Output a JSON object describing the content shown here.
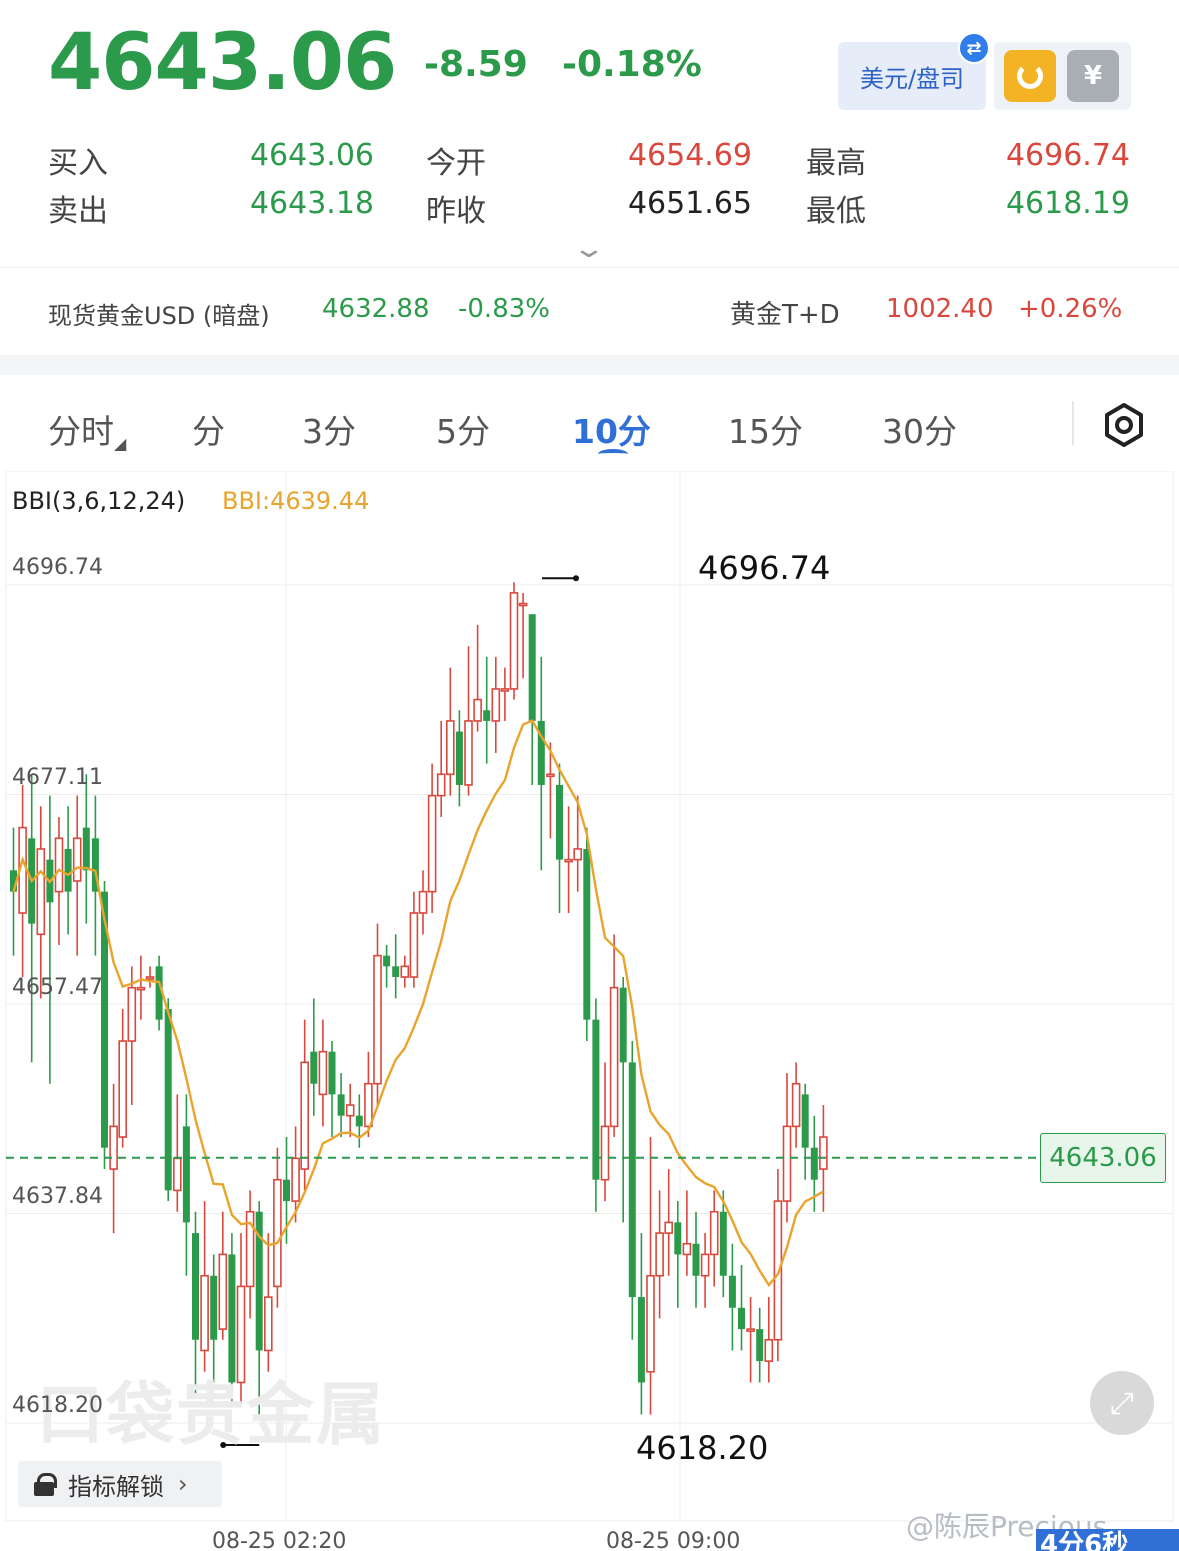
{
  "quote": {
    "price": "4643.06",
    "change": "-8.59",
    "change_pct": "-0.18%",
    "unit_toggle": "美元/盘司",
    "bid_label": "买入",
    "bid": "4643.06",
    "ask_label": "卖出",
    "ask": "4643.18",
    "open_label": "今开",
    "open": "4654.69",
    "prev_close_label": "昨收",
    "prev_close": "4651.65",
    "high_label": "最高",
    "high": "4696.74",
    "low_label": "最低",
    "low": "4618.19"
  },
  "ticker": {
    "spot_name": "现货黄金USD (暗盘)",
    "spot_price": "4632.88",
    "spot_pct": "-0.83%",
    "td_name": "黄金T+D",
    "td_price": "1002.40",
    "td_pct": "+0.26%"
  },
  "tabs": [
    {
      "label": "分时"
    },
    {
      "label": "分"
    },
    {
      "label": "3分"
    },
    {
      "label": "5分"
    },
    {
      "label": "10分"
    },
    {
      "label": "15分"
    },
    {
      "label": "30分"
    }
  ],
  "active_tab": "10分",
  "chart_meta": {
    "indicator": "BBI(3,6,12,24)",
    "indicator_value": "BBI:4639.44",
    "current_price_tag": "4643.06",
    "watermark": "口袋贵金属",
    "unlock_label": "指标解锁",
    "weibo": "@陈辰Precious",
    "countdown": "4分6秒"
  },
  "colors": {
    "up": "#d9473d",
    "down": "#2c9a4b",
    "bbi": "#e8a42c",
    "accent": "#2f6fd6"
  },
  "icons": [
    "swap-icon",
    "refresh-icon",
    "coin-icon",
    "chevron-down-icon",
    "settings-icon",
    "expand-icon",
    "lock-icon",
    "chevron-right-icon"
  ],
  "chart_data": {
    "type": "candlestick",
    "ylim": [
      4618.2,
      4696.74
    ],
    "y_ticks": [
      "4696.74",
      "4677.11",
      "4657.47",
      "4637.84",
      "4618.20"
    ],
    "x_ticks": [
      "08-25 02:20",
      "08-25 09:00"
    ],
    "high_marker": "4696.74",
    "low_marker": "4618.20",
    "current_price": 4643.06,
    "candles": [
      [
        4670,
        4668,
        4674,
        4662
      ],
      [
        4666,
        4674,
        4678,
        4660
      ],
      [
        4673,
        4665,
        4679,
        4652
      ],
      [
        4664,
        4672,
        4676,
        4658
      ],
      [
        4671,
        4667,
        4677,
        4650
      ],
      [
        4668,
        4673,
        4675,
        4663
      ],
      [
        4672,
        4668,
        4676,
        4664
      ],
      [
        4669,
        4673,
        4677,
        4662
      ],
      [
        4674,
        4670,
        4679,
        4665
      ],
      [
        4673,
        4668,
        4677,
        4662
      ],
      [
        4668,
        4644,
        4669,
        4642
      ],
      [
        4642,
        4646,
        4650,
        4636
      ],
      [
        4645,
        4654,
        4657,
        4644
      ],
      [
        4654,
        4659,
        4661,
        4648
      ],
      [
        4659,
        4659,
        4662,
        4656
      ],
      [
        4660,
        4660,
        4661,
        4659
      ],
      [
        4661,
        4656,
        4662,
        4655
      ],
      [
        4657,
        4640,
        4658,
        4639
      ],
      [
        4640,
        4643,
        4649,
        4638
      ],
      [
        4646,
        4637,
        4649,
        4632
      ],
      [
        4636,
        4626,
        4638,
        4621
      ],
      [
        4625,
        4632,
        4639,
        4623
      ],
      [
        4632,
        4626,
        4634,
        4622
      ],
      [
        4627,
        4634,
        4638,
        4626
      ],
      [
        4634,
        4622,
        4636,
        4620
      ],
      [
        4622,
        4631,
        4636,
        4620
      ],
      [
        4631,
        4638,
        4640,
        4628
      ],
      [
        4638,
        4625,
        4639,
        4619
      ],
      [
        4625,
        4630,
        4636,
        4623
      ],
      [
        4631,
        4641,
        4644,
        4629
      ],
      [
        4641,
        4639,
        4645,
        4635
      ],
      [
        4639,
        4643,
        4646,
        4637
      ],
      [
        4642,
        4652,
        4656,
        4640
      ],
      [
        4653,
        4650,
        4658,
        4647
      ],
      [
        4649,
        4653,
        4656,
        4646
      ],
      [
        4653,
        4649,
        4654,
        4645
      ],
      [
        4649,
        4647,
        4651,
        4645
      ],
      [
        4647,
        4648,
        4650,
        4645
      ],
      [
        4647,
        4646,
        4649,
        4644
      ],
      [
        4646,
        4650,
        4653,
        4645
      ],
      [
        4650,
        4662,
        4665,
        4648
      ],
      [
        4662,
        4661,
        4663,
        4659
      ],
      [
        4661,
        4660,
        4664,
        4658
      ],
      [
        4660,
        4661,
        4662,
        4659
      ],
      [
        4660,
        4666,
        4668,
        4659
      ],
      [
        4666,
        4668,
        4670,
        4664
      ],
      [
        4668,
        4677,
        4680,
        4666
      ],
      [
        4677,
        4679,
        4684,
        4675
      ],
      [
        4679,
        4684,
        4689,
        4677
      ],
      [
        4683,
        4678,
        4685,
        4676
      ],
      [
        4678,
        4684,
        4691,
        4677
      ],
      [
        4684,
        4686,
        4693,
        4683
      ],
      [
        4685,
        4684,
        4690,
        4680
      ],
      [
        4684,
        4687,
        4690,
        4681
      ],
      [
        4687,
        4687,
        4689,
        4684
      ],
      [
        4687,
        4696,
        4697,
        4686
      ],
      [
        4695,
        4695,
        4696,
        4688
      ],
      [
        4694,
        4684,
        4694,
        4678
      ],
      [
        4684,
        4678,
        4690,
        4670
      ],
      [
        4679,
        4679,
        4682,
        4673
      ],
      [
        4678,
        4671,
        4680,
        4666
      ],
      [
        4671,
        4671,
        4676,
        4666
      ],
      [
        4671,
        4672,
        4677,
        4668
      ],
      [
        4672,
        4656,
        4674,
        4654
      ],
      [
        4656,
        4641,
        4658,
        4638
      ],
      [
        4641,
        4646,
        4652,
        4639
      ],
      [
        4646,
        4659,
        4664,
        4645
      ],
      [
        4659,
        4652,
        4660,
        4637
      ],
      [
        4652,
        4630,
        4654,
        4626
      ],
      [
        4630,
        4622,
        4636,
        4619
      ],
      [
        4623,
        4632,
        4645,
        4619
      ],
      [
        4632,
        4636,
        4640,
        4628
      ],
      [
        4636,
        4637,
        4642,
        4632
      ],
      [
        4637,
        4634,
        4639,
        4629
      ],
      [
        4634,
        4635,
        4640,
        4632
      ],
      [
        4635,
        4632,
        4638,
        4629
      ],
      [
        4632,
        4634,
        4636,
        4629
      ],
      [
        4634,
        4638,
        4640,
        4631
      ],
      [
        4638,
        4632,
        4640,
        4630
      ],
      [
        4632,
        4629,
        4635,
        4625
      ],
      [
        4629,
        4627,
        4633,
        4625
      ],
      [
        4627,
        4627,
        4630,
        4622
      ],
      [
        4627,
        4624,
        4629,
        4622
      ],
      [
        4624,
        4626,
        4630,
        4622
      ],
      [
        4626,
        4639,
        4642,
        4624
      ],
      [
        4639,
        4646,
        4651,
        4637
      ],
      [
        4646,
        4650,
        4652,
        4644
      ],
      [
        4649,
        4644,
        4650,
        4641
      ],
      [
        4644,
        4641,
        4647,
        4638
      ],
      [
        4642,
        4645,
        4648,
        4638
      ]
    ]
  }
}
